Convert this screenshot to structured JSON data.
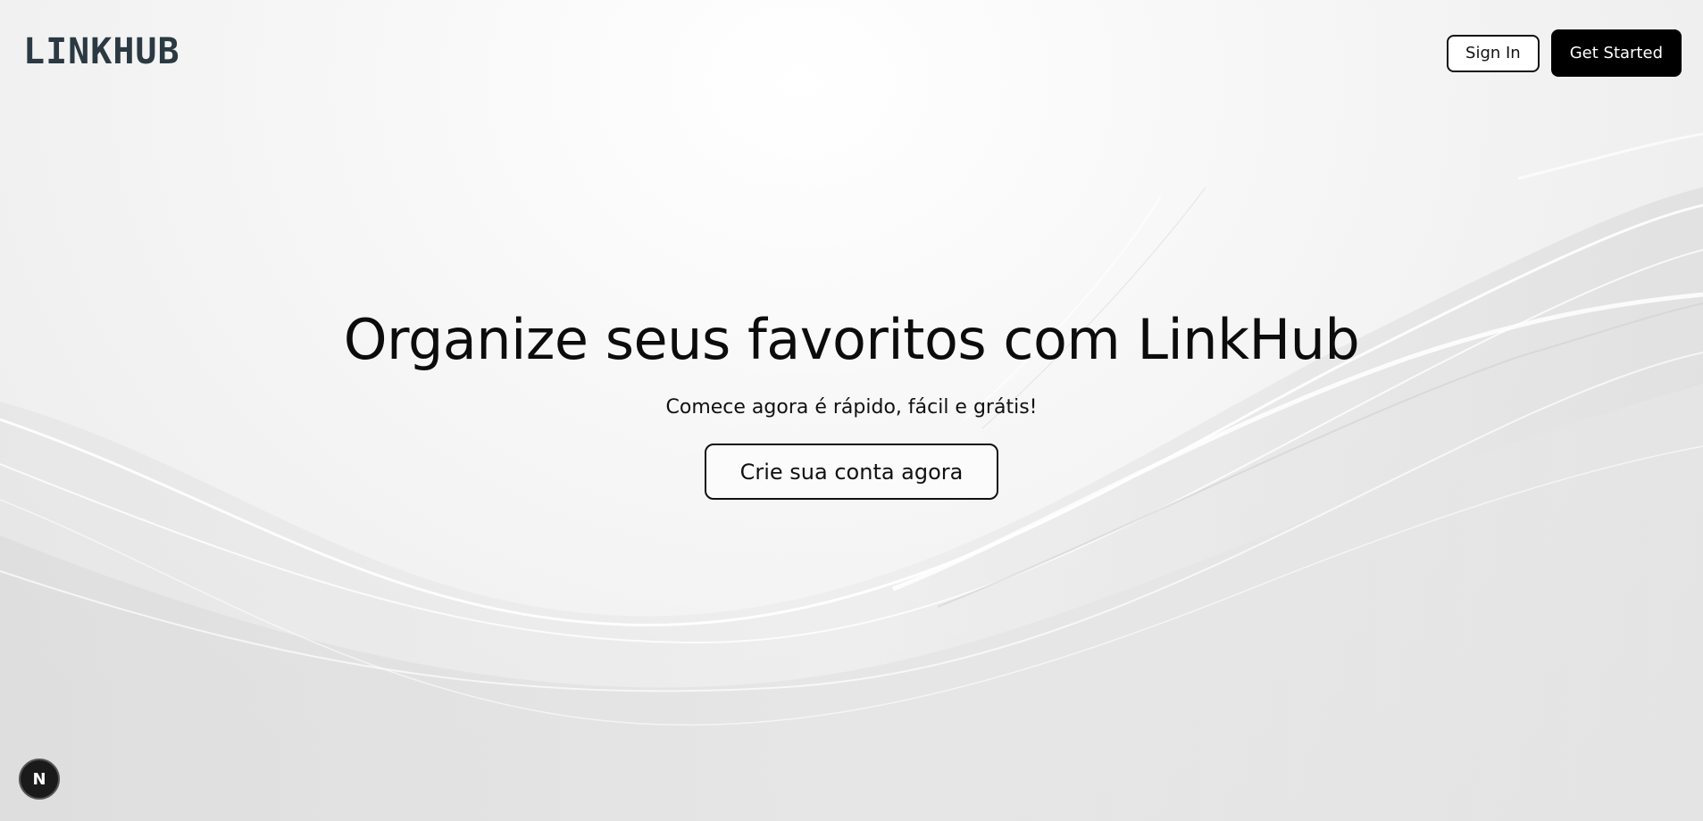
{
  "brand": {
    "logo_text": "LINKHUB"
  },
  "header": {
    "sign_in_label": "Sign In",
    "get_started_label": "Get Started"
  },
  "hero": {
    "title": "Organize seus favoritos com LinkHub",
    "subtitle": "Comece agora é rápido, fácil e grátis!",
    "cta_label": "Crie sua conta agora"
  },
  "dev_badge": {
    "letter": "N",
    "icon": "nextjs-icon"
  },
  "colors": {
    "logo": "#2b3a42",
    "primary_button_bg": "#000000",
    "primary_button_text": "#ffffff",
    "background": "#f2f2f2"
  }
}
